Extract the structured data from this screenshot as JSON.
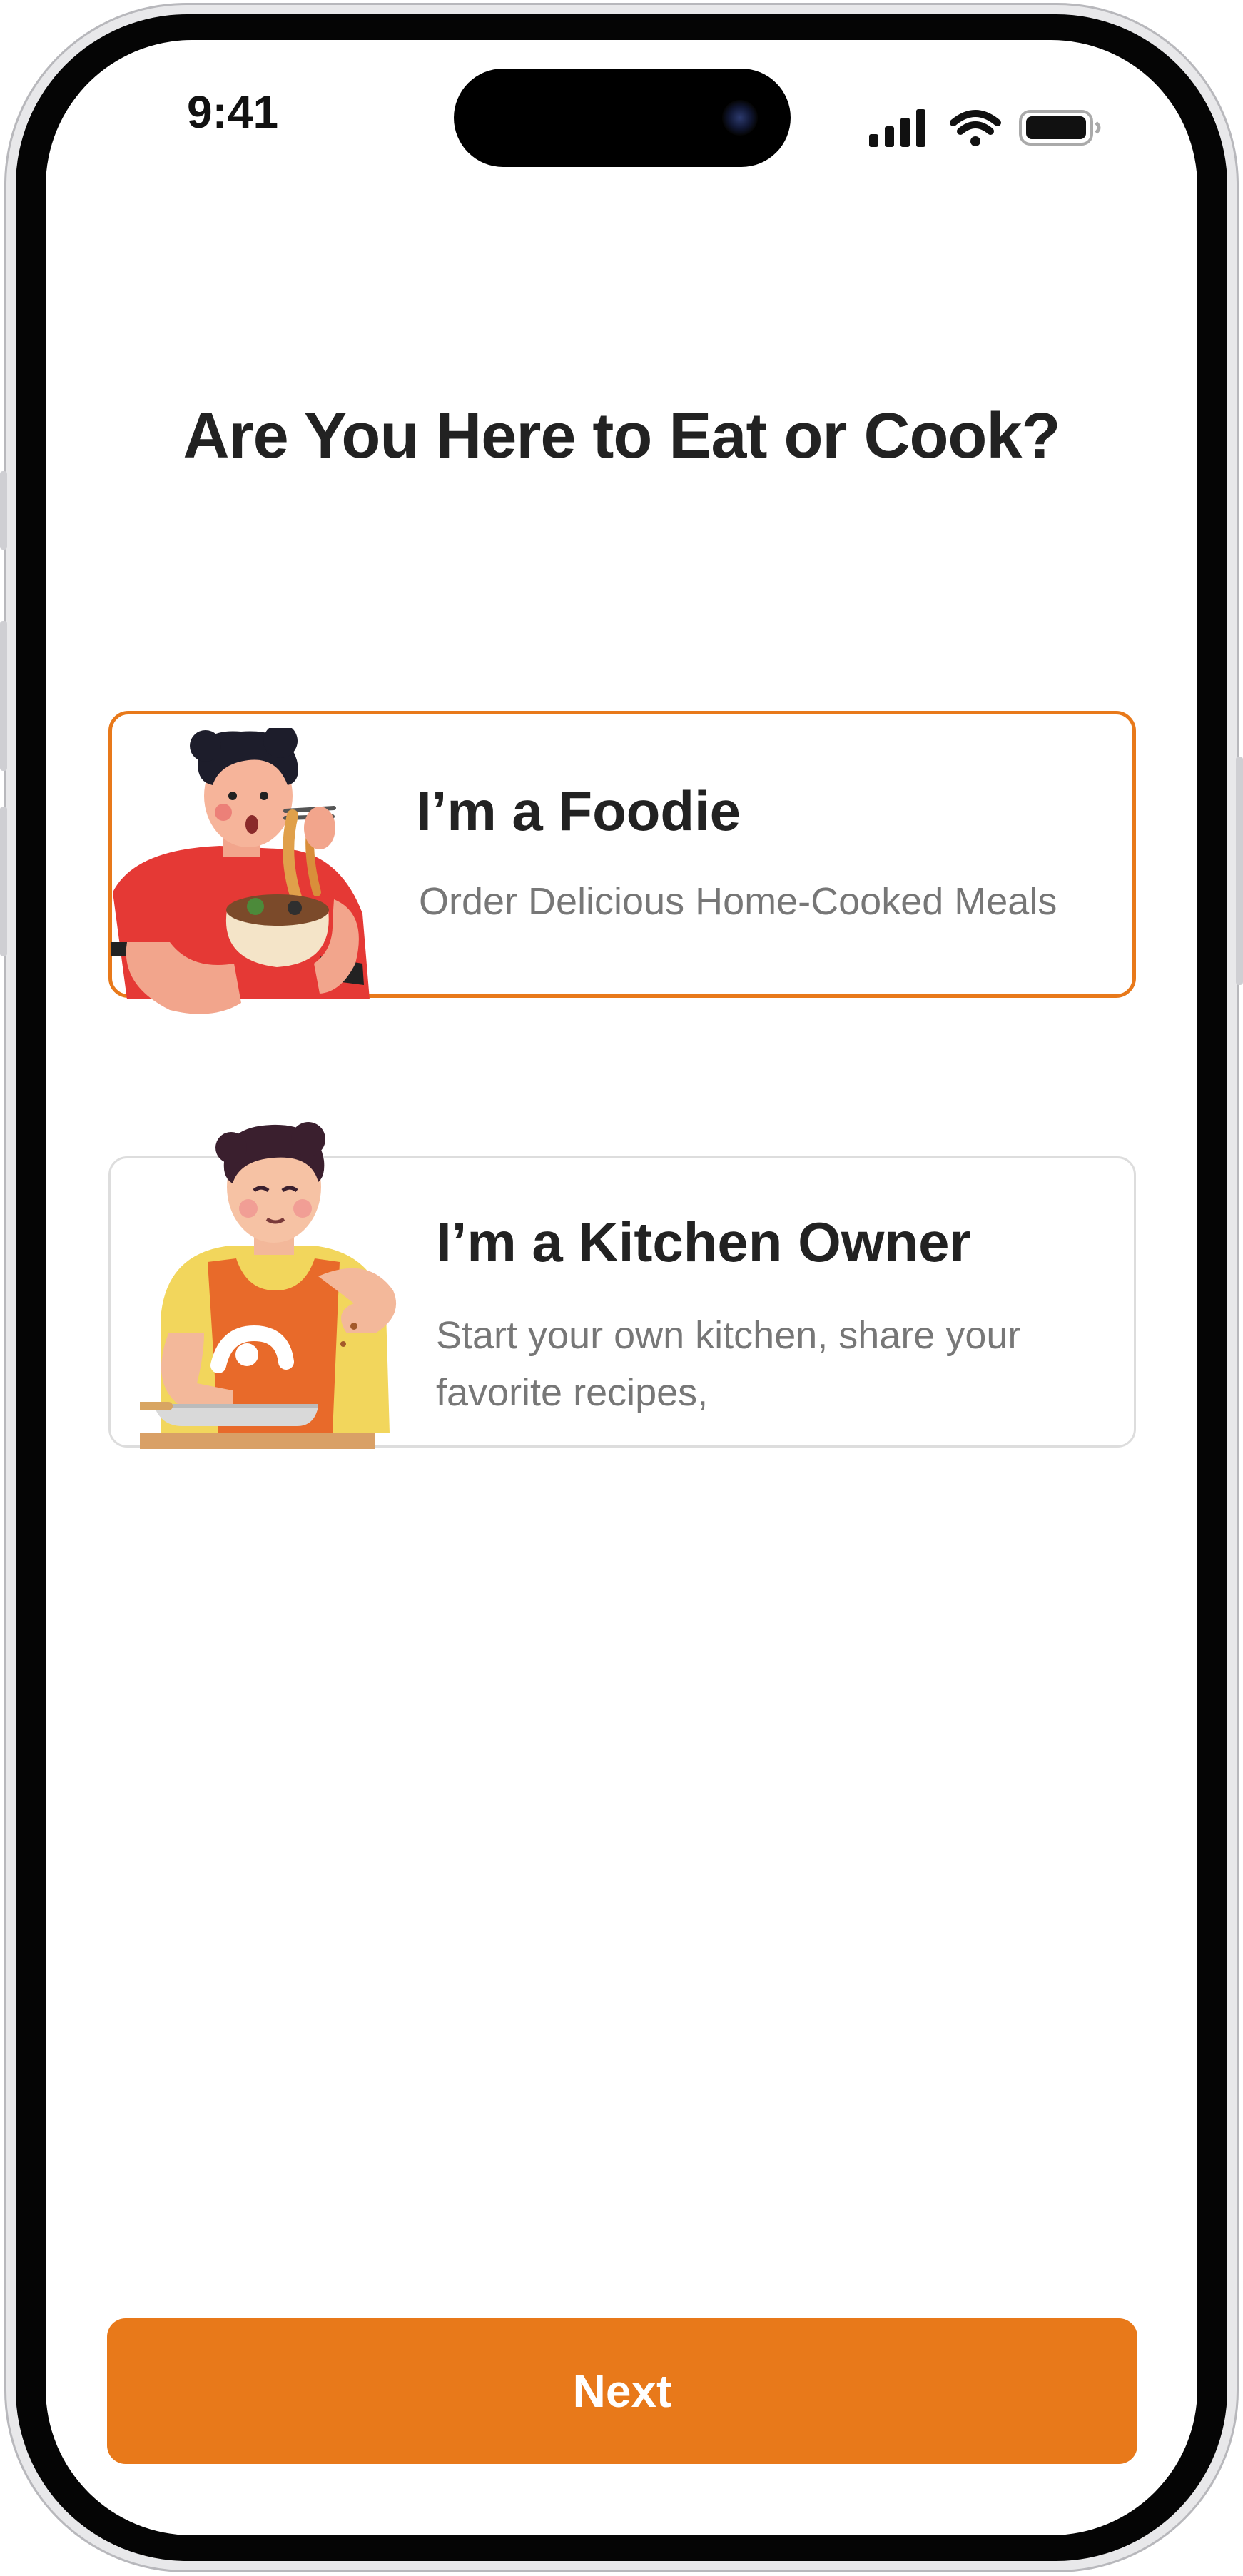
{
  "status_bar": {
    "time": "9:41",
    "icons": [
      "cellular-signal-icon",
      "wifi-icon",
      "battery-icon"
    ]
  },
  "page": {
    "title": "Are You Here to Eat or Cook?"
  },
  "options": [
    {
      "title": "I’m a Foodie",
      "subtitle": "Order Delicious Home-Cooked Meals",
      "selected": true,
      "illustration": "foodie-eating-noodles-illustration"
    },
    {
      "title": "I’m a Kitchen Owner",
      "subtitle_line1": "Start your own kitchen, share your",
      "subtitle_line2": "favorite recipes,",
      "selected": false,
      "illustration": "chef-cooking-illustration"
    }
  ],
  "actions": {
    "next_label": "Next"
  },
  "colors": {
    "accent": "#e8791a",
    "title_text": "#222222",
    "subtitle_text": "#777777",
    "card_border_unselected": "#dddddd",
    "background": "#ffffff"
  }
}
